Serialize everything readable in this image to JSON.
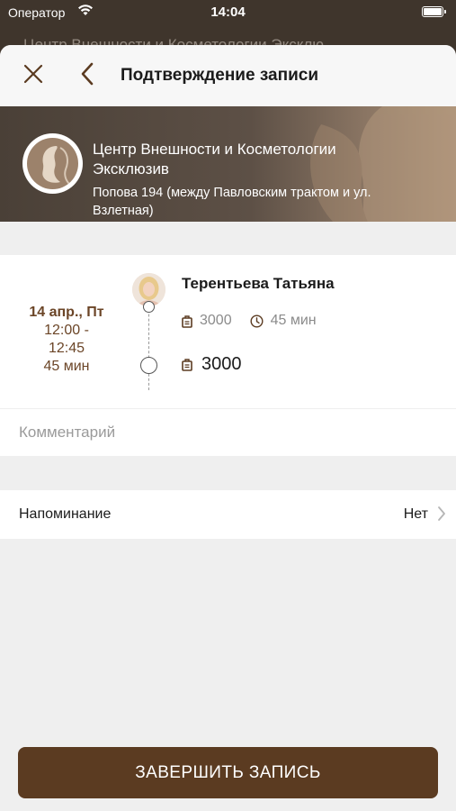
{
  "status_bar": {
    "carrier": "Оператор",
    "time": "14:04"
  },
  "background_title": "Центр Внешности и Косметологии Эксклю",
  "nav": {
    "title": "Подтверждение записи",
    "close_icon": "close-icon",
    "back_icon": "chevron-left-icon"
  },
  "salon": {
    "name": "Центр Внешности и Косметологии Эксклюзив",
    "address": "Попова 194  (между Павловским трактом и ул. Взлетная)"
  },
  "booking": {
    "date": "14 апр., Пт",
    "time_range_start": "12:00 -",
    "time_range_end": "12:45",
    "duration": "45 мин",
    "master_name": "Терентьева Татьяна",
    "service_price": "3000",
    "service_duration": "45 мин",
    "total": "3000"
  },
  "comment": {
    "placeholder": "Комментарий",
    "value": ""
  },
  "reminder": {
    "label": "Напоминание",
    "value": "Нет"
  },
  "finish_button": {
    "label": "ЗАВЕРШИТЬ ЗАПИСЬ"
  },
  "colors": {
    "accent": "#5b3b21",
    "date_text": "#6b4527",
    "sheet_background": "#efefef"
  }
}
